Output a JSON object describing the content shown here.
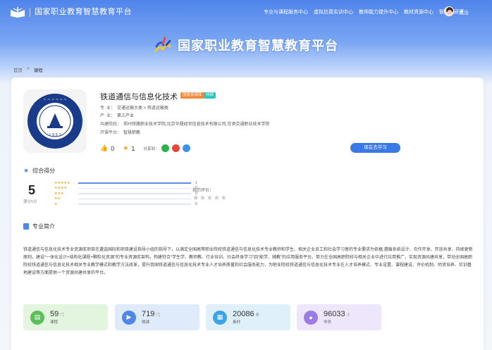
{
  "header": {
    "site_name": "国家职业教育智慧教育平台",
    "nav": [
      "专业与课程服务中心",
      "虚拟仿真实训中心",
      "教师能力提升中心",
      "教材资源中心",
      "智慧教研室"
    ],
    "logout": "退出"
  },
  "hero": {
    "title": "国家职业教育智慧教育平台"
  },
  "breadcrumb": {
    "home": "首页",
    "separator": ">",
    "current": "课程"
  },
  "course": {
    "title": "铁道通信与信息化技术",
    "tags": [
      "国家资源库",
      "持续"
    ],
    "major_label": "专",
    "major_label2": "业：",
    "major": "交通运输大类 > 铁道运输类",
    "industry_label": "产",
    "industry_label2": "业：",
    "industry": "第三产业",
    "schools_label": "共建院校：",
    "schools": "郑州铁路职业技术学院,北京华晟经世信息技术有限公司,甘肃交通职业技术学院",
    "platform_label": "开课平台：",
    "platform": "智慧职教",
    "likes": "0",
    "favorites": "1",
    "share_label": "分享到：",
    "study_button": "现在去学习"
  },
  "rating": {
    "section_title": "综合得分",
    "score": "5",
    "score_sub": "满分5分",
    "rows": [
      {
        "stars": "★★★★★",
        "count": "1",
        "fill": 1.0
      },
      {
        "stars": "★★★★",
        "count": "0",
        "fill": 0
      },
      {
        "stars": "★★★",
        "count": "0",
        "fill": 0
      },
      {
        "stars": "★★",
        "count": "0",
        "fill": 0
      },
      {
        "stars": "★",
        "count": "0",
        "fill": 0
      }
    ],
    "my_rating_label": "我的评价：",
    "my_stars": "★★★★★"
  },
  "intro": {
    "section_title": "专业简介",
    "text": "铁道通信与信息化技术专业资源库项目在遴选国际和项目建设指导小组的指导下，以满足全国高等职业院校铁道通信与信息化技术专业教师和学生、相关企业员工和社会学习者的专业需求为依据,遵循系统设计、合作开发、开放共享、持续更新原则，建设“一体化设计+结构化课程+颗粒化资源”的专业资源库架构，构建符合“学生学、教师教、行业培训、社会终身学习”四“能学、辅教”的应用服务平台。努力在全国高职院校与相关企业中进行应用推广，实现资源共建共享，带动全国高职院校铁道通信与信息化技术相关专业教学模式和教学方法改革，提升我国铁道通信与信息化技术专业人才培养质量和社会服务能力，为职业院校铁道通信与信息化技术专业在人才培养模式、专业设置、课程建设、评价机制、师资培养、实训基地建设等方面提供一个资源共建共享的平台。"
  },
  "stats": [
    {
      "value": "59",
      "unit": "门",
      "label": "课程",
      "color": "#e3f4df",
      "icon_color": "#5cbf5a",
      "icon": "book-icon"
    },
    {
      "value": "719",
      "unit": "门",
      "label": "微课",
      "color": "#dfeafb",
      "icon_color": "#4f86e8",
      "icon": "video-icon"
    },
    {
      "value": "20086",
      "unit": "条",
      "label": "素材",
      "color": "#dff0fb",
      "icon_color": "#3ea3e6",
      "icon": "file-icon"
    },
    {
      "value": "96033",
      "unit": "人",
      "label": "学员",
      "color": "#eee6fb",
      "icon_color": "#9b7be6",
      "icon": "user-icon"
    }
  ]
}
